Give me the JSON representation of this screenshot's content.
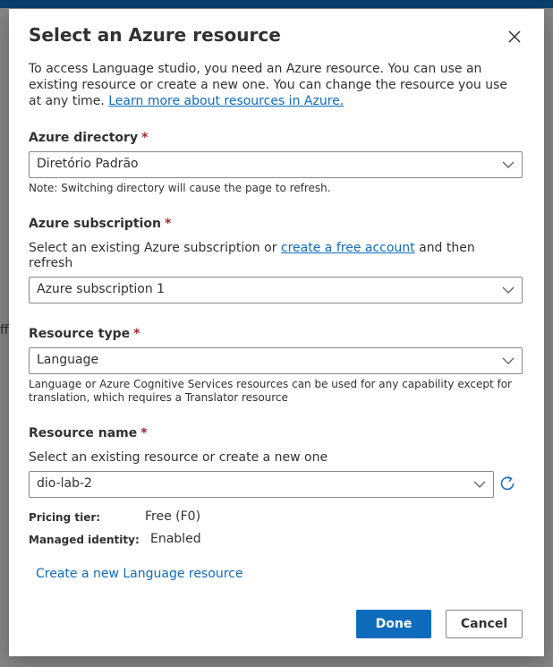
{
  "dialog": {
    "title": "Select an Azure resource",
    "intro_text": "To access Language studio, you need an Azure resource. You can use an existing resource or create a new one. You can change the resource you use at any time.",
    "intro_link": "Learn more about resources in Azure.",
    "directory": {
      "label": "Azure directory",
      "required_mark": "*",
      "value": "Diretório Padrão",
      "note": "Note: Switching directory will cause the page to refresh."
    },
    "subscription": {
      "label": "Azure subscription",
      "required_mark": "*",
      "help_before": "Select an existing Azure subscription or",
      "help_link": "create a free account",
      "help_after": "and then refresh",
      "value": "Azure subscription 1"
    },
    "resource_type": {
      "label": "Resource type",
      "required_mark": "*",
      "value": "Language",
      "note": "Language or Azure Cognitive Services resources can be used for any capability except for translation, which requires a Translator resource"
    },
    "resource_name": {
      "label": "Resource name",
      "required_mark": "*",
      "help": "Select an existing resource or create a new one",
      "value": "dio-lab-2"
    },
    "details": {
      "pricing_label": "Pricing tier:",
      "pricing_value": "Free (F0)",
      "identity_label": "Managed identity:",
      "identity_value": "Enabled"
    },
    "create_link": "Create a new Language resource",
    "done_label": "Done",
    "cancel_label": "Cancel"
  },
  "background": {
    "frag1": "ff"
  },
  "icons": {
    "close": "close-icon",
    "chevron": "chevron-down-icon",
    "refresh": "refresh-icon"
  },
  "colors": {
    "accent": "#0f6cbd",
    "required": "#a4262c",
    "topbar": "#0a3e6d"
  }
}
